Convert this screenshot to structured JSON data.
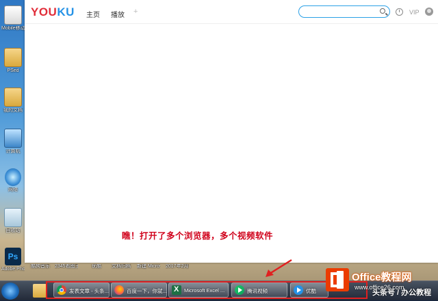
{
  "desktop": {
    "icons": [
      {
        "label": "Mobile移动"
      },
      {
        "label": "PSed"
      },
      {
        "label": "我的文档"
      },
      {
        "label": "计算机"
      },
      {
        "label": "网络"
      },
      {
        "label": "回收站"
      },
      {
        "label": "Adobe Photosh..."
      }
    ],
    "bottom_row": [
      "酷狗音乐",
      "2345看图王",
      "优酷",
      "文档归档",
      "新建 Microsoft...",
      "2017年2月份签..."
    ]
  },
  "browser": {
    "logo_you": "YOU",
    "logo_ku": "KU",
    "nav": [
      "主页",
      "播放"
    ],
    "nav_plus": "+",
    "search_placeholder": "",
    "vip_label": "VIP"
  },
  "annotation": "瞧！打开了多个浏览器，多个视频软件",
  "taskbar": {
    "buttons": [
      {
        "label": "发表文章 - 头条..."
      },
      {
        "label": "百度一下，你就..."
      },
      {
        "label": "Microsoft Excel ..."
      },
      {
        "label": "腾讯视频"
      },
      {
        "label": "优酷"
      }
    ],
    "tray_text": "头条号 / 办公教程"
  },
  "watermark": {
    "title": "Office教程网",
    "url": "www.office26.com"
  },
  "colors": {
    "annotation": "#d0021b",
    "highlight_box": "#e02020",
    "youku_red": "#e12d39",
    "youku_blue": "#2592e6"
  }
}
